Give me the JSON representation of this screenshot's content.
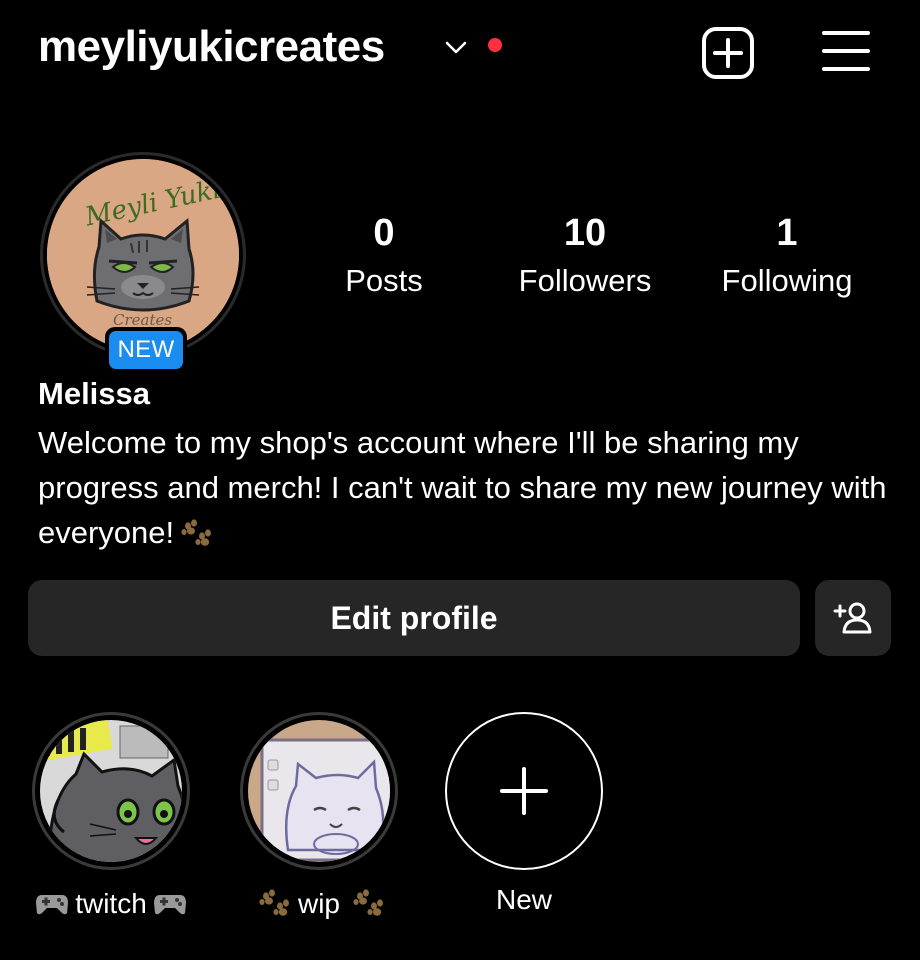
{
  "header": {
    "username": "meyliyukicreates",
    "create_icon": "plus-square-icon",
    "menu_icon": "hamburger-menu-icon",
    "notification_color": "#ff3040"
  },
  "profile": {
    "avatar_text_top": "Meyli Yuki",
    "avatar_text_bottom": "Creates",
    "new_badge": "NEW",
    "stats": {
      "posts_count": "0",
      "posts_label": "Posts",
      "followers_count": "10",
      "followers_label": "Followers",
      "following_count": "1",
      "following_label": "Following"
    },
    "name": "Melissa",
    "bio": "Welcome to my shop's account where I'll be sharing my progress and merch! I can't wait to share my new journey with everyone!"
  },
  "actions": {
    "edit_profile": "Edit profile",
    "add_user_icon": "add-person-icon"
  },
  "highlights": [
    {
      "label": "twitch"
    },
    {
      "label": "wip"
    },
    {
      "label": "New"
    }
  ],
  "colors": {
    "background": "#000000",
    "button": "#262626",
    "badge": "#1b8df0"
  }
}
